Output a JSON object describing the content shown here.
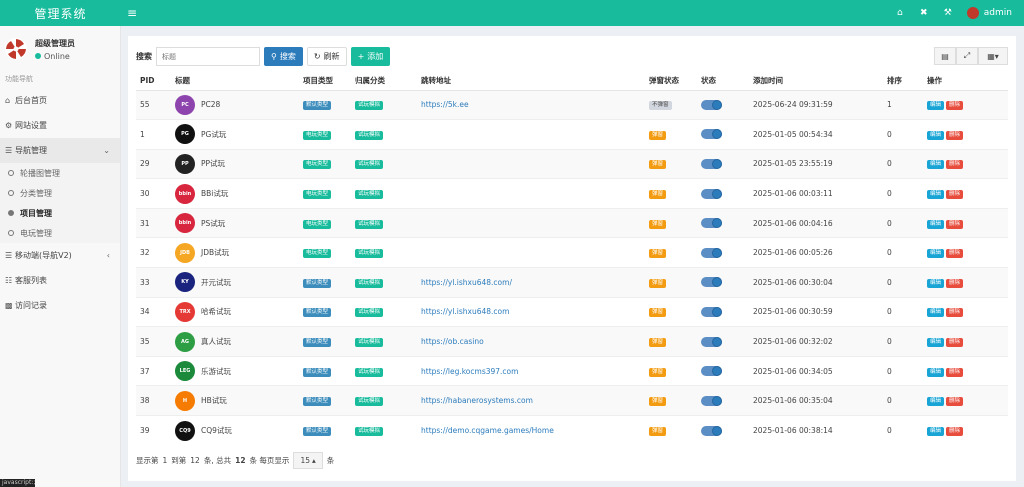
{
  "app": {
    "brand": "管理系统",
    "admin_name": "admin"
  },
  "user": {
    "name": "超级管理员",
    "status": "Online"
  },
  "sidebar": {
    "header": "功能导航",
    "items": [
      {
        "label": "后台首页",
        "icon": "home-icon"
      },
      {
        "label": "网站设置",
        "icon": "cogs-icon"
      },
      {
        "label": "导航管理",
        "icon": "database-icon"
      },
      {
        "label": "移动端(导航V2)",
        "icon": "database-icon"
      },
      {
        "label": "客服列表",
        "icon": "book-icon"
      },
      {
        "label": "访问记录",
        "icon": "bar-chart-icon"
      }
    ],
    "sub_items": [
      "轮播图管理",
      "分类管理",
      "项目管理",
      "电玩管理"
    ]
  },
  "tooltip": "javascript:;",
  "toolbar": {
    "search_label": "搜索",
    "search_placeholder": "标题",
    "search_button": "搜索",
    "refresh_button": "刷新",
    "add_button": "添加"
  },
  "table": {
    "headers": [
      "PID",
      "标题",
      "项目类型",
      "归属分类",
      "跳转地址",
      "弹窗状态",
      "状态",
      "添加时间",
      "排序",
      "操作"
    ],
    "edit_label": "编辑",
    "delete_label": "删除",
    "rows": [
      {
        "pid": "55",
        "title": "PC28",
        "type": "默认类型",
        "category": "试玩模拟",
        "url": "https://5k.ee",
        "popup": "不弹窗",
        "time": "2025-06-24 09:31:59",
        "sort": "1",
        "icon_color": "#8e44ad",
        "icon_text": "PC"
      },
      {
        "pid": "1",
        "title": "PG试玩",
        "type": "电玩类型",
        "category": "试玩模拟",
        "url": "",
        "popup": "弹窗",
        "time": "2025-01-05 00:54:34",
        "sort": "0",
        "icon_color": "#111111",
        "icon_text": "PG"
      },
      {
        "pid": "29",
        "title": "PP试玩",
        "type": "电玩类型",
        "category": "试玩模拟",
        "url": "",
        "popup": "弹窗",
        "time": "2025-01-05 23:55:19",
        "sort": "0",
        "icon_color": "#222222",
        "icon_text": "PP"
      },
      {
        "pid": "30",
        "title": "BBi试玩",
        "type": "电玩类型",
        "category": "试玩模拟",
        "url": "",
        "popup": "弹窗",
        "time": "2025-01-06 00:03:11",
        "sort": "0",
        "icon_color": "#d7263d",
        "icon_text": "bbin"
      },
      {
        "pid": "31",
        "title": "PS试玩",
        "type": "电玩类型",
        "category": "试玩模拟",
        "url": "",
        "popup": "弹窗",
        "time": "2025-01-06 00:04:16",
        "sort": "0",
        "icon_color": "#d7263d",
        "icon_text": "bbin"
      },
      {
        "pid": "32",
        "title": "JDB试玩",
        "type": "电玩类型",
        "category": "试玩模拟",
        "url": "",
        "popup": "弹窗",
        "time": "2025-01-06 00:05:26",
        "sort": "0",
        "icon_color": "#f5a623",
        "icon_text": "JDB"
      },
      {
        "pid": "33",
        "title": "开元试玩",
        "type": "默认类型",
        "category": "试玩模拟",
        "url": "https://yl.ishxu648.com/",
        "popup": "弹窗",
        "time": "2025-01-06 00:30:04",
        "sort": "0",
        "icon_color": "#1a237e",
        "icon_text": "KY"
      },
      {
        "pid": "34",
        "title": "哈希试玩",
        "type": "默认类型",
        "category": "试玩模拟",
        "url": "https://yl.ishxu648.com",
        "popup": "弹窗",
        "time": "2025-01-06 00:30:59",
        "sort": "0",
        "icon_color": "#e53935",
        "icon_text": "TRX"
      },
      {
        "pid": "35",
        "title": "真人试玩",
        "type": "默认类型",
        "category": "试玩模拟",
        "url": "https://ob.casino",
        "popup": "弹窗",
        "time": "2025-01-06 00:32:02",
        "sort": "0",
        "icon_color": "#2e9e44",
        "icon_text": "AG"
      },
      {
        "pid": "37",
        "title": "乐游试玩",
        "type": "默认类型",
        "category": "试玩模拟",
        "url": "https://leg.kocms397.com",
        "popup": "弹窗",
        "time": "2025-01-06 00:34:05",
        "sort": "0",
        "icon_color": "#1b8a3a",
        "icon_text": "LEG"
      },
      {
        "pid": "38",
        "title": "HB试玩",
        "type": "默认类型",
        "category": "试玩模拟",
        "url": "https://habanerosystems.com",
        "popup": "弹窗",
        "time": "2025-01-06 00:35:04",
        "sort": "0",
        "icon_color": "#f57c00",
        "icon_text": "H"
      },
      {
        "pid": "39",
        "title": "CQ9试玩",
        "type": "默认类型",
        "category": "试玩模拟",
        "url": "https://demo.cqgame.games/Home",
        "popup": "弹窗",
        "time": "2025-01-06 00:38:14",
        "sort": "0",
        "icon_color": "#111111",
        "icon_text": "CQ9"
      }
    ]
  },
  "pager": {
    "prefix": "显示第",
    "from": "1",
    "to_label": "到第",
    "to": "12",
    "mid": "条, 总共",
    "total": "12",
    "per_page_label": "条  每页显示",
    "page_size": "15",
    "suffix": "条"
  },
  "colors": {
    "accent": "#18bc9c",
    "primary": "#2c7cbc",
    "danger": "#e74c3c",
    "warning": "#f39c12"
  }
}
